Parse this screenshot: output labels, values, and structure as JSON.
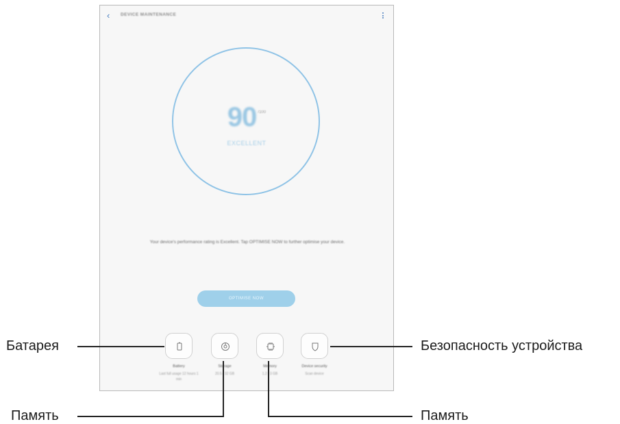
{
  "app": {
    "title": "DEVICE MAINTENANCE"
  },
  "score": {
    "value": "90",
    "unit": "/100",
    "status": "EXCELLENT"
  },
  "message": "Your device's performance rating is Excellent. Tap OPTIMISE NOW to further optimise your device.",
  "optimize_button": "OPTIMISE NOW",
  "features": [
    {
      "label": "Battery",
      "value": "Last full usage 12 hours 1 min"
    },
    {
      "label": "Storage",
      "value": "20.5 / 32 GB"
    },
    {
      "label": "Memory",
      "value": "1.2 / 3 GB"
    },
    {
      "label": "Device security",
      "value": "Scan device"
    }
  ],
  "callouts": {
    "battery": "Батарея",
    "storage": "Память",
    "memory": "Память",
    "security": "Безопасность устройства"
  },
  "colors": {
    "accent": "#4a7fc0",
    "ring": "#8fc3e6",
    "button": "#9fd0ea"
  }
}
